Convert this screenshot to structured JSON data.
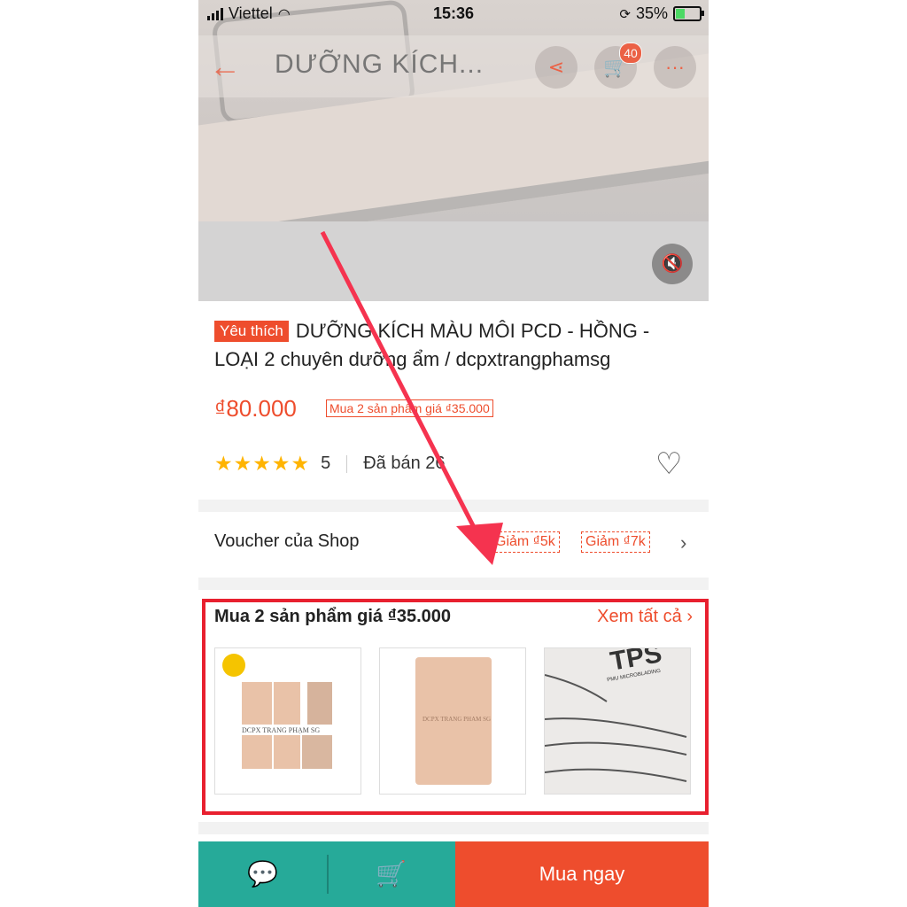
{
  "status_bar": {
    "carrier": "Viettel",
    "time": "15:36",
    "battery": "35%"
  },
  "nav": {
    "title": "DƯỠNG KÍCH...",
    "cart_count": "40"
  },
  "product": {
    "tag": "Yêu thích",
    "title": "DƯỠNG KÍCH MÀU MÔI PCD - HỒNG - LOẠI 2 chuyên dưỡng ẩm  / dcpxtrangphamsg",
    "price": "₫80.000",
    "deal_tag": "Mua 2 sản phẩm giá ₫35.000",
    "stars": "★★★★★",
    "rating": "5",
    "sold": "Đã bán 26"
  },
  "voucher": {
    "label": "Voucher của Shop",
    "chips": [
      "Giảm ₫5k",
      "Giảm ₫7k"
    ]
  },
  "bundle": {
    "title": "Mua 2 sản phẩm giá ₫35.000",
    "see_all": "Xem tất cả",
    "thumb1_caption": "DCPX TRANG PHẠM SG",
    "thumb2_caption": "DCPX TRANG PHAM SG",
    "thumb3_brand": "TPS",
    "thumb3_sub": "PMU MICROBLADING"
  },
  "bottom": {
    "buy_now": "Mua ngay"
  },
  "colors": {
    "accent": "#ee4d2d",
    "teal": "#26aa99",
    "highlight": "#e8202f"
  }
}
